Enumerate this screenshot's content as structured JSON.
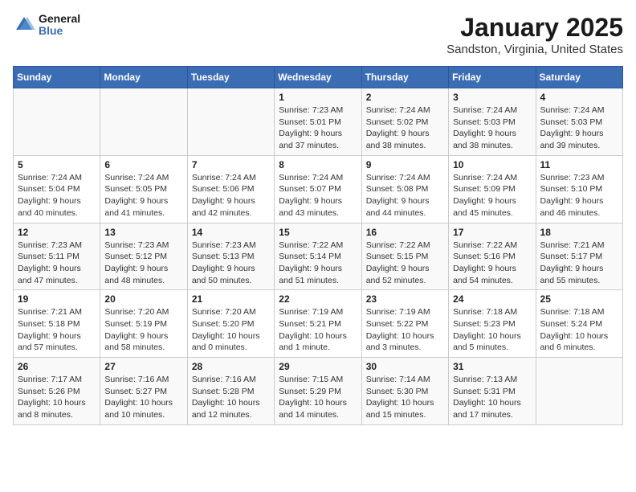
{
  "header": {
    "logo_general": "General",
    "logo_blue": "Blue",
    "month_title": "January 2025",
    "location": "Sandston, Virginia, United States"
  },
  "days_of_week": [
    "Sunday",
    "Monday",
    "Tuesday",
    "Wednesday",
    "Thursday",
    "Friday",
    "Saturday"
  ],
  "weeks": [
    [
      {
        "day": "",
        "content": ""
      },
      {
        "day": "",
        "content": ""
      },
      {
        "day": "",
        "content": ""
      },
      {
        "day": "1",
        "content": "Sunrise: 7:23 AM\nSunset: 5:01 PM\nDaylight: 9 hours and 37 minutes."
      },
      {
        "day": "2",
        "content": "Sunrise: 7:24 AM\nSunset: 5:02 PM\nDaylight: 9 hours and 38 minutes."
      },
      {
        "day": "3",
        "content": "Sunrise: 7:24 AM\nSunset: 5:03 PM\nDaylight: 9 hours and 38 minutes."
      },
      {
        "day": "4",
        "content": "Sunrise: 7:24 AM\nSunset: 5:03 PM\nDaylight: 9 hours and 39 minutes."
      }
    ],
    [
      {
        "day": "5",
        "content": "Sunrise: 7:24 AM\nSunset: 5:04 PM\nDaylight: 9 hours and 40 minutes."
      },
      {
        "day": "6",
        "content": "Sunrise: 7:24 AM\nSunset: 5:05 PM\nDaylight: 9 hours and 41 minutes."
      },
      {
        "day": "7",
        "content": "Sunrise: 7:24 AM\nSunset: 5:06 PM\nDaylight: 9 hours and 42 minutes."
      },
      {
        "day": "8",
        "content": "Sunrise: 7:24 AM\nSunset: 5:07 PM\nDaylight: 9 hours and 43 minutes."
      },
      {
        "day": "9",
        "content": "Sunrise: 7:24 AM\nSunset: 5:08 PM\nDaylight: 9 hours and 44 minutes."
      },
      {
        "day": "10",
        "content": "Sunrise: 7:24 AM\nSunset: 5:09 PM\nDaylight: 9 hours and 45 minutes."
      },
      {
        "day": "11",
        "content": "Sunrise: 7:23 AM\nSunset: 5:10 PM\nDaylight: 9 hours and 46 minutes."
      }
    ],
    [
      {
        "day": "12",
        "content": "Sunrise: 7:23 AM\nSunset: 5:11 PM\nDaylight: 9 hours and 47 minutes."
      },
      {
        "day": "13",
        "content": "Sunrise: 7:23 AM\nSunset: 5:12 PM\nDaylight: 9 hours and 48 minutes."
      },
      {
        "day": "14",
        "content": "Sunrise: 7:23 AM\nSunset: 5:13 PM\nDaylight: 9 hours and 50 minutes."
      },
      {
        "day": "15",
        "content": "Sunrise: 7:22 AM\nSunset: 5:14 PM\nDaylight: 9 hours and 51 minutes."
      },
      {
        "day": "16",
        "content": "Sunrise: 7:22 AM\nSunset: 5:15 PM\nDaylight: 9 hours and 52 minutes."
      },
      {
        "day": "17",
        "content": "Sunrise: 7:22 AM\nSunset: 5:16 PM\nDaylight: 9 hours and 54 minutes."
      },
      {
        "day": "18",
        "content": "Sunrise: 7:21 AM\nSunset: 5:17 PM\nDaylight: 9 hours and 55 minutes."
      }
    ],
    [
      {
        "day": "19",
        "content": "Sunrise: 7:21 AM\nSunset: 5:18 PM\nDaylight: 9 hours and 57 minutes."
      },
      {
        "day": "20",
        "content": "Sunrise: 7:20 AM\nSunset: 5:19 PM\nDaylight: 9 hours and 58 minutes."
      },
      {
        "day": "21",
        "content": "Sunrise: 7:20 AM\nSunset: 5:20 PM\nDaylight: 10 hours and 0 minutes."
      },
      {
        "day": "22",
        "content": "Sunrise: 7:19 AM\nSunset: 5:21 PM\nDaylight: 10 hours and 1 minute."
      },
      {
        "day": "23",
        "content": "Sunrise: 7:19 AM\nSunset: 5:22 PM\nDaylight: 10 hours and 3 minutes."
      },
      {
        "day": "24",
        "content": "Sunrise: 7:18 AM\nSunset: 5:23 PM\nDaylight: 10 hours and 5 minutes."
      },
      {
        "day": "25",
        "content": "Sunrise: 7:18 AM\nSunset: 5:24 PM\nDaylight: 10 hours and 6 minutes."
      }
    ],
    [
      {
        "day": "26",
        "content": "Sunrise: 7:17 AM\nSunset: 5:26 PM\nDaylight: 10 hours and 8 minutes."
      },
      {
        "day": "27",
        "content": "Sunrise: 7:16 AM\nSunset: 5:27 PM\nDaylight: 10 hours and 10 minutes."
      },
      {
        "day": "28",
        "content": "Sunrise: 7:16 AM\nSunset: 5:28 PM\nDaylight: 10 hours and 12 minutes."
      },
      {
        "day": "29",
        "content": "Sunrise: 7:15 AM\nSunset: 5:29 PM\nDaylight: 10 hours and 14 minutes."
      },
      {
        "day": "30",
        "content": "Sunrise: 7:14 AM\nSunset: 5:30 PM\nDaylight: 10 hours and 15 minutes."
      },
      {
        "day": "31",
        "content": "Sunrise: 7:13 AM\nSunset: 5:31 PM\nDaylight: 10 hours and 17 minutes."
      },
      {
        "day": "",
        "content": ""
      }
    ]
  ]
}
